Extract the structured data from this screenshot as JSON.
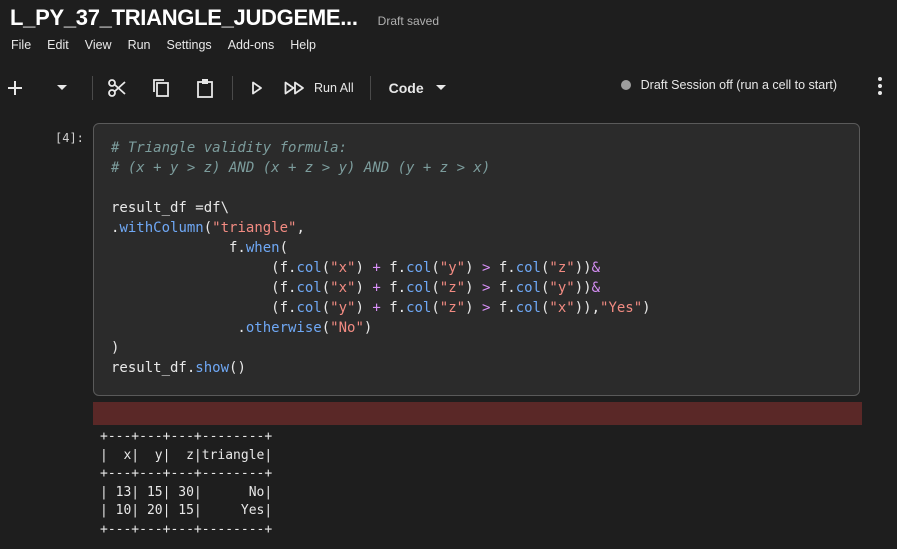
{
  "notebook": {
    "title": "L_PY_37_TRIANGLE_JUDGEME...",
    "status": "Draft saved"
  },
  "menu": [
    "File",
    "Edit",
    "View",
    "Run",
    "Settings",
    "Add-ons",
    "Help"
  ],
  "toolbar": {
    "run_all_label": "Run All",
    "cell_type": "Code",
    "session_status": "Draft Session off (run a cell to start)"
  },
  "cell": {
    "execution_count": "[4]:",
    "comment_1": "# Triangle validity formula:",
    "comment_2": "# (x + y > z) AND (x + z > y) AND (y + z > x)",
    "str_triangle": "\"triangle\"",
    "str_x": "\"x\"",
    "str_y": "\"y\"",
    "str_z": "\"z\"",
    "str_yes": "\"Yes\"",
    "str_no": "\"No\""
  },
  "output": {
    "border": "+---+---+---+--------+",
    "header": "|  x|  y|  z|triangle|",
    "rows": [
      "| 13| 15| 30|      No|",
      "| 10| 20| 15|     Yes|"
    ]
  },
  "colors": {
    "background": "#1e1e1e",
    "cell_bg": "#2b2b2b",
    "function": "#6fa8f5",
    "string": "#f28b82",
    "operator": "#d68ff5",
    "comment": "#7c9c9c",
    "error_bar": "#5a2827"
  }
}
